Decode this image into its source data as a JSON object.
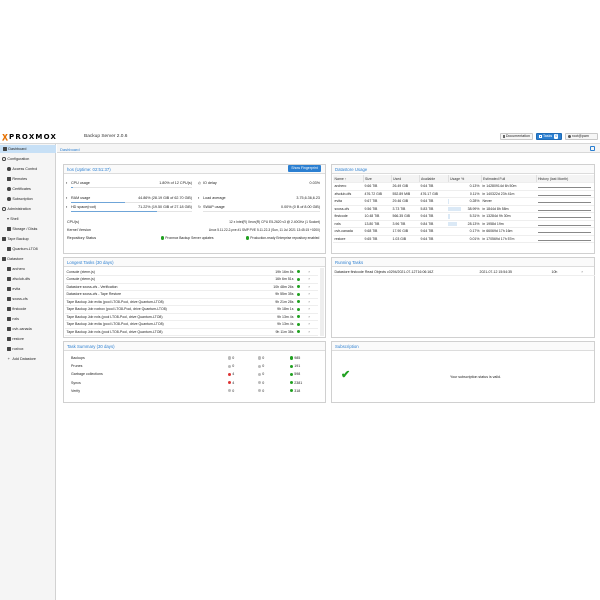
{
  "header": {
    "logo_text": "PROXMOX",
    "product": "Backup Server 2.0.6",
    "documentation": "Documentation",
    "tasks": "Tasks",
    "tasks_count": "0",
    "user": "root@pam"
  },
  "sidebar": {
    "items": [
      {
        "label": "Dashboard"
      },
      {
        "label": "Configuration"
      },
      {
        "label": "Access Control"
      },
      {
        "label": "Remotes"
      },
      {
        "label": "Certificates"
      },
      {
        "label": "Subscription"
      },
      {
        "label": "Administration"
      },
      {
        "label": "Shell"
      },
      {
        "label": "Storage / Disks"
      },
      {
        "label": "Tape Backup"
      },
      {
        "label": "Quantum-LTO8"
      },
      {
        "label": "Datastore"
      },
      {
        "label": "archero"
      },
      {
        "label": "zfsclub-dfs"
      },
      {
        "label": "evita"
      },
      {
        "label": "sxoss-cfs"
      },
      {
        "label": "firstcode"
      },
      {
        "label": "nxls"
      },
      {
        "label": "ovh-canada"
      },
      {
        "label": "restore"
      },
      {
        "label": "roxbox"
      },
      {
        "label": "Add Datastore"
      }
    ]
  },
  "breadcrumb": "Dashboard",
  "host": {
    "title": "hos (Uptime: 02:51:37)",
    "show_fingerprint": "Show Fingerprint",
    "cpu_label": "CPU usage",
    "cpu_value": "1.80% of 12 CPU(s)",
    "cpu_fraction": 0.018,
    "iodelay_label": "IO delay",
    "iodelay_value": "0.03%",
    "ram_label": "RAM usage",
    "ram_value": "44.86% (28.19 GiB of 62.70 GiB)",
    "ram_fraction": 0.4486,
    "load_label": "Load average",
    "load_value": "3.75,6.36,6.23",
    "hd_label": "HD space(root)",
    "hd_value": "71.22% (19.50 GiB of 27.18 GiB)",
    "hd_fraction": 0.7122,
    "swap_label": "SWAP usage",
    "swap_value": "0.00% (0 B of 8.00 GiB)",
    "swap_fraction": 0.0,
    "cpus_label": "CPU(s)",
    "cpus_value": "12 x Intel(R) Xeon(R) CPU E5-2620 v3 @ 2.40GHz (1 Socket)",
    "kernel_label": "Kernel Version",
    "kernel_value": "Linux 5.11.22-2-pve #1 SMP PVE 5.11.22-3 (Sun, 11 Jul 2021 13:45:15 +0200)",
    "repo_label": "Repository Status",
    "repo_value1": "Proxmox Backup Server updates",
    "repo_value2": "Production-ready Enterprise repository enabled"
  },
  "datastore_usage": {
    "title": "Datastore Usage",
    "columns": [
      "Name ↑",
      "Size",
      "Used",
      "Available",
      "Usage %",
      "Estimated Full",
      "History (last Month)"
    ],
    "rows": [
      {
        "name": "archero",
        "size": "9.66 TiB",
        "used": "26.49 GiB",
        "avail": "9.64 TiB",
        "usage": "0.13%",
        "usage_frac": 0.0013,
        "full": "in 14280914d 6h 50m"
      },
      {
        "name": "zfsclub-dfs",
        "size": "476.72 GiB",
        "used": "552.89 MiB",
        "avail": "476.17 GiB",
        "usage": "0.11%",
        "usage_frac": 0.0011,
        "full": "in 140322d 23h 41m"
      },
      {
        "name": "evita",
        "size": "9.67 TiB",
        "used": "29.46 GiB",
        "avail": "9.64 TiB",
        "usage": "0.28%",
        "usage_frac": 0.0028,
        "full": "Never"
      },
      {
        "name": "sxoss-cfs",
        "size": "9.56 TiB",
        "used": "3.73 TiB",
        "avail": "5.83 TiB",
        "usage": "38.99%",
        "usage_frac": 0.3899,
        "full": "in 1844d 8h 58m"
      },
      {
        "name": "firstcode",
        "size": "10.48 TiB",
        "used": "566.35 GiB",
        "avail": "9.64 TiB",
        "usage": "5.31%",
        "usage_frac": 0.0531,
        "full": "in 13284d 9h 30m"
      },
      {
        "name": "nxls",
        "size": "13.80 TiB",
        "used": "3.96 TiB",
        "avail": "9.84 TiB",
        "usage": "28.13%",
        "usage_frac": 0.2813,
        "full": "in 1958d 19m"
      },
      {
        "name": "ovh-canada",
        "size": "9.68 TiB",
        "used": "17.90 GiB",
        "avail": "9.64 TiB",
        "usage": "0.17%",
        "usage_frac": 0.0017,
        "full": "in 66069d 17h 16m"
      },
      {
        "name": "restore",
        "size": "9.65 TiB",
        "used": "1.03 GiB",
        "avail": "9.64 TiB",
        "usage": "0.01%",
        "usage_frac": 0.0001,
        "full": "in 170569d 17h 57m"
      }
    ]
  },
  "longest_tasks": {
    "title": "Longest Tasks (30 days)",
    "rows": [
      {
        "name": "Console (xterm.js)",
        "dur": "19h 16m 8s"
      },
      {
        "name": "Console (xterm.js)",
        "dur": "16h 6m 51s"
      },
      {
        "name": "Datastore sxoss-cfs - Verification",
        "dur": "10h 48m 26s"
      },
      {
        "name": "Datastore sxoss-cfs - Tape Restore",
        "dur": "9h 55m 35s"
      },
      {
        "name": "Tape Backup Job evita (pool LTO8-Pool, drive Quantum-LTO8)",
        "dur": "9h 21m 28s"
      },
      {
        "name": "Tape Backup Job roxbox (pool LTO8-Pool, drive Quantum-LTO8)",
        "dur": "9h 18m 1s"
      },
      {
        "name": "Tape Backup Job nxls (pool LTO8-Pool, drive Quantum-LTO8)",
        "dur": "9h 13m 4s"
      },
      {
        "name": "Tape Backup Job evita (pool LTO8-Pool, drive Quantum-LTO8)",
        "dur": "9h 13m 4s"
      },
      {
        "name": "Tape Backup Job nxls (pool LTO8-Pool, drive Quantum-LTO8)",
        "dur": "9h 11m 38s"
      },
      {
        "name": "Tape Backup Job evita (pool LTO8-Pool, drive Quantum-LTO8)",
        "dur": "9h 10m 20s"
      }
    ]
  },
  "running_tasks": {
    "title": "Running Tasks",
    "rows": [
      {
        "name": "Datastore firstcode Read Objects c0294/2021-07-12T16:06:16Z",
        "start": "2021-07-12 15:54:35",
        "dur": "10h"
      }
    ]
  },
  "task_summary": {
    "title": "Task Summary (30 days)",
    "rows": [
      {
        "name": "Backups",
        "a": "0",
        "b": "0",
        "c": "985",
        "a_state": "zero",
        "b_state": "zero"
      },
      {
        "name": "Prunes",
        "a": "0",
        "b": "0",
        "c": "191",
        "a_state": "zero",
        "b_state": "zero"
      },
      {
        "name": "Garbage collections",
        "a": "4",
        "b": "0",
        "c": "598",
        "a_state": "err",
        "b_state": "zero"
      },
      {
        "name": "Syncs",
        "a": "4",
        "b": "0",
        "c": "2381",
        "a_state": "err",
        "b_state": "zero"
      },
      {
        "name": "Verify",
        "a": "0",
        "b": "0",
        "c": "318",
        "a_state": "zero",
        "b_state": "zero"
      }
    ]
  },
  "subscription": {
    "title": "Subscription",
    "message": "Your subscription status is valid."
  },
  "colors": {
    "accent": "#2b7fd1",
    "ok": "#21a121",
    "err": "#d33333",
    "logo": "#e57000"
  }
}
